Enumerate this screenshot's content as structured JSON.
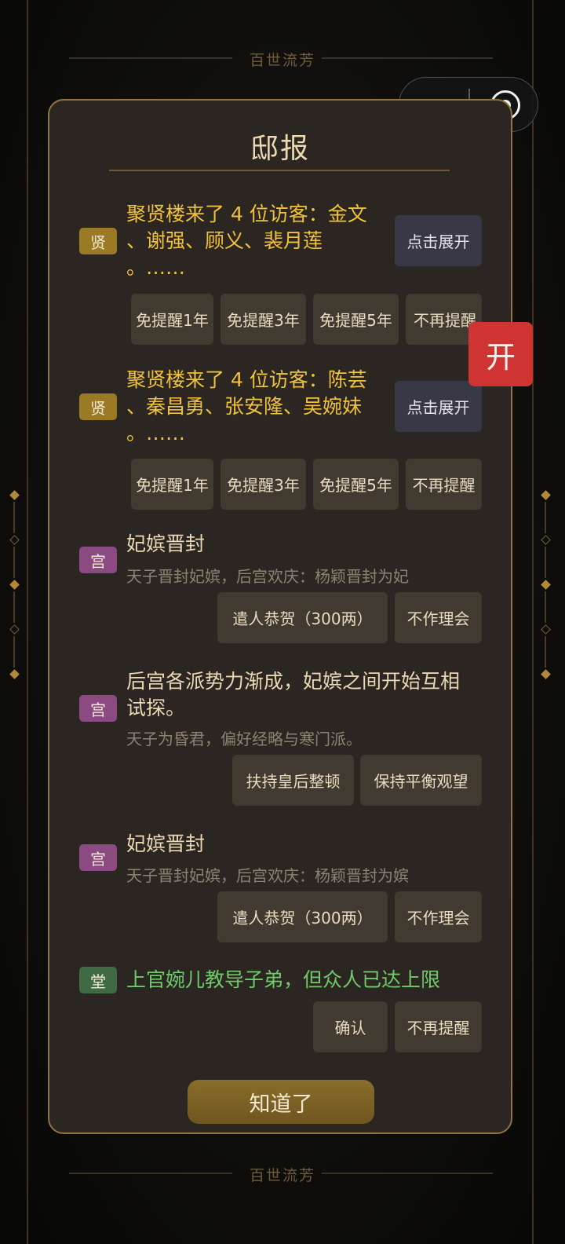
{
  "background": {
    "top_title": "百世流芳",
    "bottom_title": "百世流芳"
  },
  "capsule": {
    "more_icon": "more-dots-icon",
    "close_icon": "target-circle-icon"
  },
  "dialog": {
    "title": "邸报",
    "messages": [
      {
        "tag": "贤",
        "text": "聚贤楼来了 4 位访客：金文、谢强、顾义、裴月莲。……",
        "lines": [
          "聚贤楼来了 4 位访客：金文",
          "、谢强、顾义、裴月莲",
          "。……"
        ],
        "expand_label": "点击展开",
        "actions": [
          "免提醒1年",
          "免提醒3年",
          "免提醒5年",
          "不再提醒"
        ]
      },
      {
        "tag": "贤",
        "text": "聚贤楼来了 4 位访客：陈芸、秦昌勇、张安隆、吴婉妹。……",
        "lines": [
          "聚贤楼来了 4 位访客：陈芸",
          "、秦昌勇、张安隆、吴婉妹",
          "。……"
        ],
        "expand_label": "点击展开",
        "actions": [
          "免提醒1年",
          "免提醒3年",
          "免提醒5年",
          "不再提醒"
        ]
      },
      {
        "tag": "宫",
        "title": "妃嫔晋封",
        "subtitle": "天子晋封妃嫔，后宫欢庆：杨颖晋封为妃",
        "actions": [
          "遣人恭贺（300两）",
          "不作理会"
        ]
      },
      {
        "tag": "宫",
        "lines": [
          "后宫各派势力渐成，妃嫔之间开始互相",
          "试探。"
        ],
        "subtitle": "天子为昏君，偏好经略与寒门派。",
        "actions": [
          "扶持皇后整顿",
          "保持平衡观望"
        ]
      },
      {
        "tag": "宫",
        "title": "妃嫔晋封",
        "subtitle": "天子晋封妃嫔，后宫欢庆：杨颖晋封为嫔",
        "actions": [
          "遣人恭贺（300两）",
          "不作理会"
        ]
      },
      {
        "tag": "堂",
        "text": "上官婉儿教导子弟，但众人已达上限",
        "actions": [
          "确认",
          "不再提醒"
        ]
      }
    ],
    "ok_label": "知道了"
  },
  "floating": {
    "open_label": "开"
  },
  "colors": {
    "dialog_bg": "#2b2621",
    "dialog_border": "#8e7541",
    "gold_text": "#f1c23d",
    "green_text": "#6fcb6c",
    "tag_xian": "#9a7a24",
    "tag_gong": "#8b4a82",
    "tag_tang": "#3f6a44",
    "open_button": "#cf3432"
  }
}
